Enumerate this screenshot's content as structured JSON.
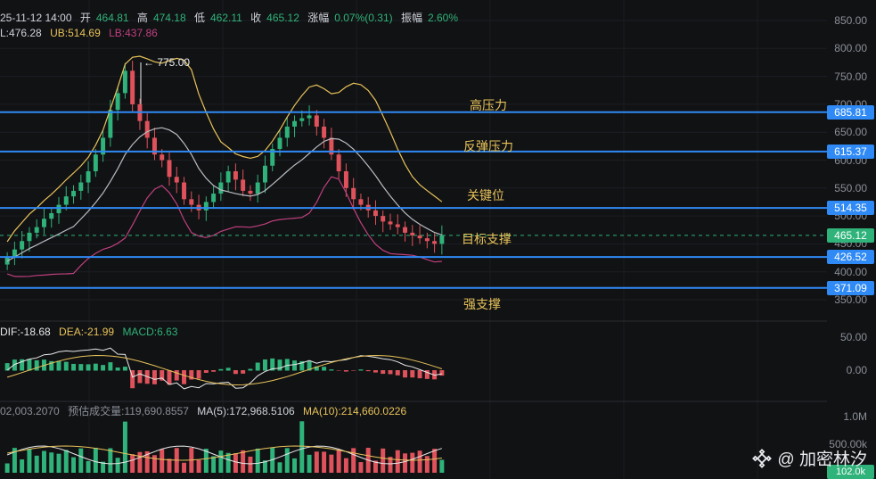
{
  "header": {
    "line1": {
      "date": "25-11-12 14:00",
      "open_label": "开",
      "open": "464.81",
      "high_label": "高",
      "high": "474.18",
      "low_label": "低",
      "low": "462.11",
      "close_label": "收",
      "close": "465.12",
      "change_label": "涨幅",
      "change": "0.07%(0.31)",
      "amp_label": "振幅",
      "amp": "2.60%"
    },
    "line2": {
      "mid": "L:476.28",
      "ub": "UB:514.69",
      "lb": "LB:437.86"
    },
    "macd": {
      "dif": "DIF:-18.68",
      "dea": "DEA:-21.99",
      "macd": "MACD:6.63"
    },
    "volume": {
      "vol": "02,003.2070",
      "est": "预估成交量:119,690.8557",
      "ma5": "MA(5):172,968.5106",
      "ma10": "MA(10):214,660.0226"
    }
  },
  "peak_label": "← 775.00",
  "price_axis": [
    "850.00",
    "800.00",
    "750.00",
    "700.00",
    "650.00",
    "600.00",
    "550.00",
    "500.00",
    "450.00",
    "400.00",
    "350.00"
  ],
  "macd_axis": [
    "50.00",
    "0.00"
  ],
  "volume_axis": [
    "1.0M",
    "500.00k"
  ],
  "volume_tag": "102.0k",
  "levels": [
    {
      "value": "685.81",
      "label": "高压力"
    },
    {
      "value": "615.37",
      "label": "反弹压力"
    },
    {
      "value": "514.35",
      "label": "关键位"
    },
    {
      "value": "426.52",
      "label": "目标支撑"
    },
    {
      "value": "371.09",
      "label": "强支撑"
    }
  ],
  "current_price": "465.12",
  "colors": {
    "up": "#2fb37a",
    "down": "#e0525b",
    "level": "#2f8af5",
    "mid": "#b9bcc2",
    "upper": "#e8c35a",
    "lower": "#c0407f",
    "macd_dif": "#e8e8e8",
    "macd_dea": "#e8c35a"
  },
  "watermark": {
    "icon": "binance-diamond-icon",
    "text": "@ 加密林汐"
  },
  "chart_data": [
    {
      "type": "candlestick",
      "title": "",
      "ylim": [
        340,
        860
      ],
      "grid": true,
      "close_series": [
        425,
        440,
        455,
        470,
        480,
        495,
        505,
        520,
        535,
        545,
        560,
        580,
        610,
        640,
        690,
        720,
        760,
        700,
        670,
        640,
        610,
        600,
        570,
        560,
        530,
        520,
        510,
        525,
        540,
        560,
        580,
        565,
        545,
        540,
        560,
        590,
        620,
        640,
        660,
        670,
        675,
        680,
        660,
        640,
        610,
        580,
        550,
        530,
        520,
        510,
        500,
        490,
        485,
        480,
        470,
        465,
        460,
        455,
        450,
        465
      ],
      "bollinger": {
        "mid_last": 476.28,
        "upper_last": 514.69,
        "lower_last": 437.86
      },
      "levels": [
        685.81,
        615.37,
        514.35,
        426.52,
        371.09
      ],
      "last_price": 465.12,
      "peak": 775.0
    },
    {
      "type": "macd",
      "series": [
        {
          "name": "DIF",
          "last": -18.68
        },
        {
          "name": "DEA",
          "last": -21.99
        },
        {
          "name": "MACD",
          "last": 6.63
        }
      ],
      "ylim": [
        -60,
        70
      ]
    },
    {
      "type": "bar",
      "series": [
        {
          "name": "MA(5)",
          "last": 172968.5106
        },
        {
          "name": "MA(10)",
          "last": 214660.0226
        }
      ],
      "last_volume": "102.0k"
    }
  ]
}
